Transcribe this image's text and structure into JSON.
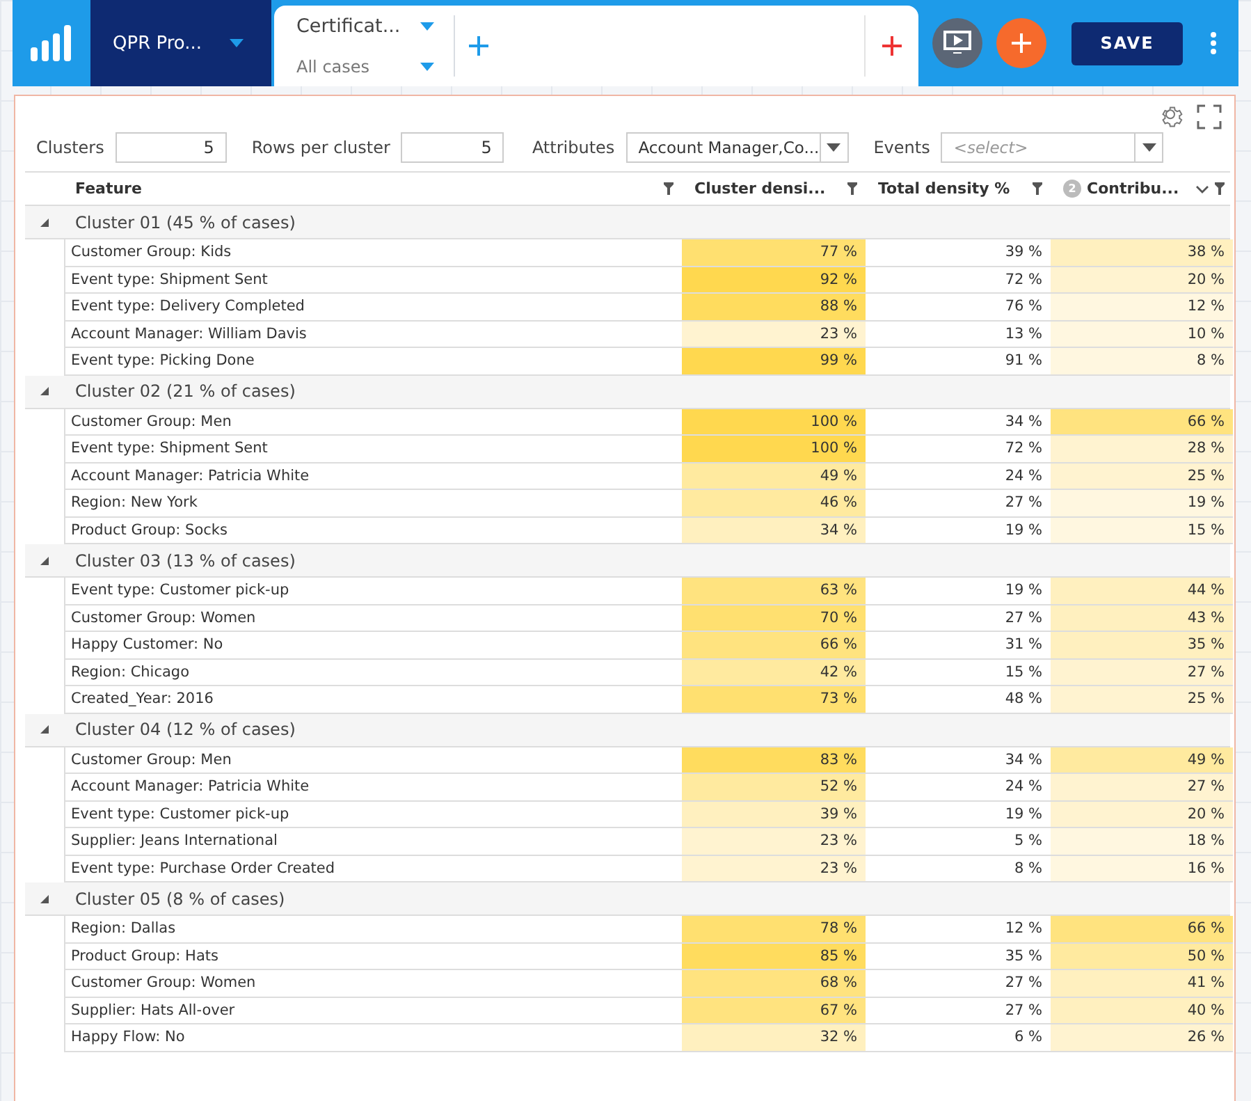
{
  "topbar": {
    "project": "QPR Pro...",
    "model_tab": {
      "title": "Certificat...",
      "filter": "All cases"
    },
    "save": "SAVE"
  },
  "controls": {
    "clusters_label": "Clusters",
    "clusters": "5",
    "rows_label": "Rows per cluster",
    "rows": "5",
    "attributes_label": "Attributes",
    "attributes": "Account Manager,Co...",
    "events_label": "Events",
    "events_placeholder": "<select>"
  },
  "table": {
    "columns": [
      {
        "label": "Feature",
        "sort_descending": false
      },
      {
        "label": "Cluster densi...",
        "sort_descending": false
      },
      {
        "label": "Total density %",
        "sort_descending": false
      },
      {
        "label": "Contribu...",
        "sort_badge": "2",
        "sort_descending": true
      }
    ],
    "groups": [
      {
        "title": "Cluster 01 (45 % of cases)",
        "expanded": true,
        "rows": [
          {
            "feature": "Customer Group: Kids",
            "density": {
              "text": "77 %",
              "color": "#ffe070"
            },
            "total": "39 %",
            "contribution": {
              "text": "38 %",
              "color": "#fff0bf"
            }
          },
          {
            "feature": "Event type: Shipment Sent",
            "density": {
              "text": "92 %",
              "color": "#ffd84f"
            },
            "total": "72 %",
            "contribution": {
              "text": "20 %",
              "color": "#fff3d0"
            }
          },
          {
            "feature": "Event type: Delivery Completed",
            "density": {
              "text": "88 %",
              "color": "#ffdc5e"
            },
            "total": "76 %",
            "contribution": {
              "text": "12 %",
              "color": "#fff7e0"
            }
          },
          {
            "feature": "Account Manager: William Davis",
            "density": {
              "text": "23 %",
              "color": "#fff3d0"
            },
            "total": "13 %",
            "contribution": {
              "text": "10 %",
              "color": "#fff7e0"
            }
          },
          {
            "feature": "Event type: Picking Done",
            "density": {
              "text": "99 %",
              "color": "#ffd84f"
            },
            "total": "91 %",
            "contribution": {
              "text": "8 %",
              "color": "#fff7e0"
            }
          }
        ]
      },
      {
        "title": "Cluster 02 (21 % of cases)",
        "expanded": true,
        "rows": [
          {
            "feature": "Customer Group: Men",
            "density": {
              "text": "100 %",
              "color": "#ffd84f"
            },
            "total": "34 %",
            "contribution": {
              "text": "66 %",
              "color": "#ffe37f"
            }
          },
          {
            "feature": "Event type: Shipment Sent",
            "density": {
              "text": "100 %",
              "color": "#ffd84f"
            },
            "total": "72 %",
            "contribution": {
              "text": "28 %",
              "color": "#fff3d0"
            }
          },
          {
            "feature": "Account Manager: Patricia White",
            "density": {
              "text": "49 %",
              "color": "#ffea9f"
            },
            "total": "24 %",
            "contribution": {
              "text": "25 %",
              "color": "#fff3d0"
            }
          },
          {
            "feature": "Region: New York",
            "density": {
              "text": "46 %",
              "color": "#ffea9f"
            },
            "total": "27 %",
            "contribution": {
              "text": "19 %",
              "color": "#fff7e0"
            }
          },
          {
            "feature": "Product Group: Socks",
            "density": {
              "text": "34 %",
              "color": "#fff0bf"
            },
            "total": "19 %",
            "contribution": {
              "text": "15 %",
              "color": "#fff7e0"
            }
          }
        ]
      },
      {
        "title": "Cluster 03 (13 % of cases)",
        "expanded": true,
        "rows": [
          {
            "feature": "Event type: Customer pick-up",
            "density": {
              "text": "63 %",
              "color": "#ffe37f"
            },
            "total": "19 %",
            "contribution": {
              "text": "44 %",
              "color": "#fff0bf"
            }
          },
          {
            "feature": "Customer Group: Women",
            "density": {
              "text": "70 %",
              "color": "#ffe070"
            },
            "total": "27 %",
            "contribution": {
              "text": "43 %",
              "color": "#fff0bf"
            }
          },
          {
            "feature": "Happy Customer: No",
            "density": {
              "text": "66 %",
              "color": "#ffe37f"
            },
            "total": "31 %",
            "contribution": {
              "text": "35 %",
              "color": "#fff0bf"
            }
          },
          {
            "feature": "Region: Chicago",
            "density": {
              "text": "42 %",
              "color": "#ffea9f"
            },
            "total": "15 %",
            "contribution": {
              "text": "27 %",
              "color": "#fff3d0"
            }
          },
          {
            "feature": "Created_Year: 2016",
            "density": {
              "text": "73 %",
              "color": "#ffe070"
            },
            "total": "48 %",
            "contribution": {
              "text": "25 %",
              "color": "#fff3d0"
            }
          }
        ]
      },
      {
        "title": "Cluster 04 (12 % of cases)",
        "expanded": true,
        "rows": [
          {
            "feature": "Customer Group: Men",
            "density": {
              "text": "83 %",
              "color": "#ffdc5e"
            },
            "total": "34 %",
            "contribution": {
              "text": "49 %",
              "color": "#ffea9f"
            }
          },
          {
            "feature": "Account Manager: Patricia White",
            "density": {
              "text": "52 %",
              "color": "#ffea9f"
            },
            "total": "24 %",
            "contribution": {
              "text": "27 %",
              "color": "#fff3d0"
            }
          },
          {
            "feature": "Event type: Customer pick-up",
            "density": {
              "text": "39 %",
              "color": "#fff0bf"
            },
            "total": "19 %",
            "contribution": {
              "text": "20 %",
              "color": "#fff3d0"
            }
          },
          {
            "feature": "Supplier: Jeans International",
            "density": {
              "text": "23 %",
              "color": "#fff3d0"
            },
            "total": "5 %",
            "contribution": {
              "text": "18 %",
              "color": "#fff7e0"
            }
          },
          {
            "feature": "Event type: Purchase Order Created",
            "density": {
              "text": "23 %",
              "color": "#fff3d0"
            },
            "total": "8 %",
            "contribution": {
              "text": "16 %",
              "color": "#fff7e0"
            }
          }
        ]
      },
      {
        "title": "Cluster 05 (8 % of cases)",
        "expanded": true,
        "rows": [
          {
            "feature": "Region: Dallas",
            "density": {
              "text": "78 %",
              "color": "#ffe070"
            },
            "total": "12 %",
            "contribution": {
              "text": "66 %",
              "color": "#ffe37f"
            }
          },
          {
            "feature": "Product Group: Hats",
            "density": {
              "text": "85 %",
              "color": "#ffdc5e"
            },
            "total": "35 %",
            "contribution": {
              "text": "50 %",
              "color": "#ffea9f"
            }
          },
          {
            "feature": "Customer Group: Women",
            "density": {
              "text": "68 %",
              "color": "#ffe37f"
            },
            "total": "27 %",
            "contribution": {
              "text": "41 %",
              "color": "#fff0bf"
            }
          },
          {
            "feature": "Supplier: Hats All-over",
            "density": {
              "text": "67 %",
              "color": "#ffe37f"
            },
            "total": "27 %",
            "contribution": {
              "text": "40 %",
              "color": "#fff0bf"
            }
          },
          {
            "feature": "Happy Flow: No",
            "density": {
              "text": "32 %",
              "color": "#fff0bf"
            },
            "total": "6 %",
            "contribution": {
              "text": "26 %",
              "color": "#fff3d0"
            }
          }
        ]
      }
    ]
  }
}
